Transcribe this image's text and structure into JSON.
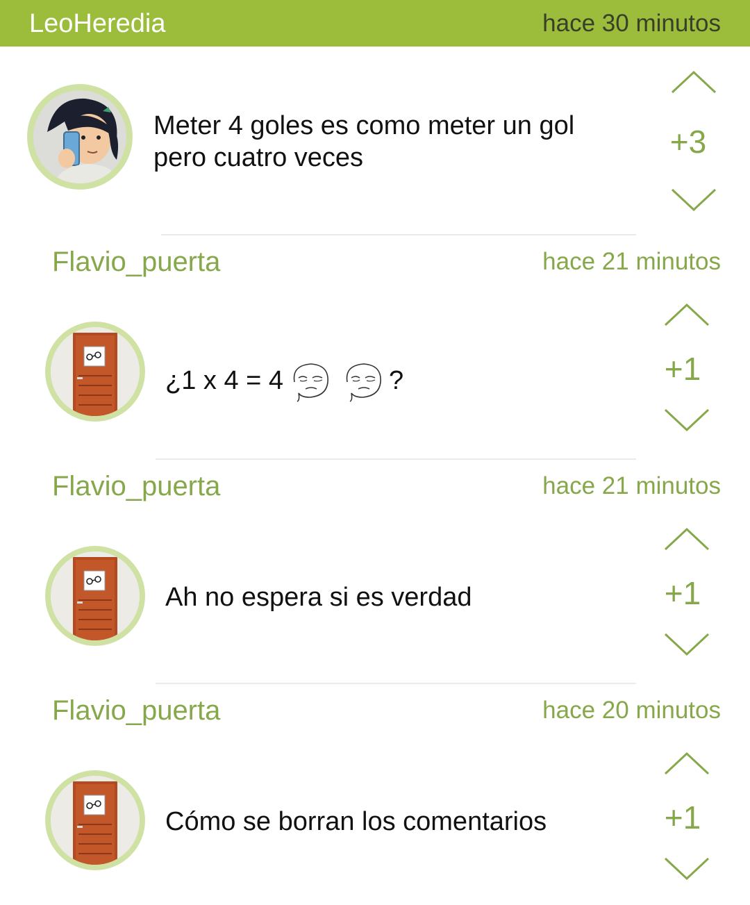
{
  "top": {
    "username": "LeoHeredia",
    "time": "hace 30 minutos"
  },
  "comments": [
    {
      "text": "Meter 4 goles es como meter un gol pero cuatro veces",
      "score": "+3"
    },
    {
      "username": "Flavio_puerta",
      "time": "hace 21 minutos",
      "text_before": "¿1 x 4 = 4",
      "text_after": "?",
      "emoji": "meme-face-icon",
      "score": "+1"
    },
    {
      "username": "Flavio_puerta",
      "time": "hace 21 minutos",
      "text": "Ah no espera si es verdad",
      "score": "+1"
    },
    {
      "username": "Flavio_puerta",
      "time": "hace 20 minutos",
      "text": "Cómo se borran los comentarios",
      "score": "+1"
    }
  ],
  "colors": {
    "brand_green": "#9bbd3b",
    "accent_green": "#86a84a",
    "avatar_ring": "#cfe2a4"
  }
}
